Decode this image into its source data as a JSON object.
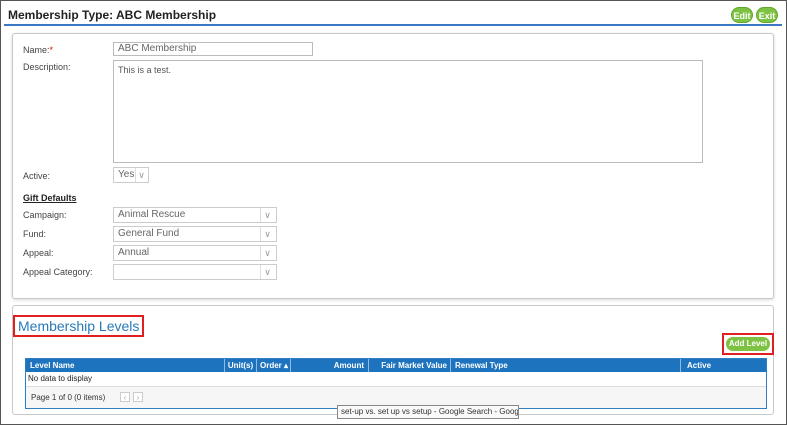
{
  "header": {
    "title": "Membership Type: ABC Membership",
    "edit_label": "Edit",
    "exit_label": "Exit"
  },
  "form": {
    "name_label": "Name:",
    "name_required": "*",
    "name_value": "ABC Membership",
    "description_label": "Description:",
    "description_value": "This is a test.",
    "active_label": "Active:",
    "active_value": "Yes",
    "gift_defaults_title": "Gift Defaults",
    "campaign_label": "Campaign:",
    "campaign_value": "Animal Rescue",
    "fund_label": "Fund:",
    "fund_value": "General Fund",
    "appeal_label": "Appeal:",
    "appeal_value": "Annual",
    "appeal_category_label": "Appeal Category:",
    "appeal_category_value": ""
  },
  "levels": {
    "title": "Membership Levels",
    "add_label": "Add Level",
    "columns": [
      "Level Name",
      "Unit(s)",
      "Order",
      "Amount",
      "Fair Market Value",
      "Renewal Type",
      "Active"
    ],
    "empty_text": "No data to display",
    "pager_text": "Page 1 of 0 (0 items)"
  },
  "tooltip": {
    "text": "set-up vs. set up vs setup - Google Search - Google"
  },
  "colors": {
    "accent_green": "#7dc242",
    "grid_header_blue": "#1e73be",
    "title_blue": "#2a7ab8",
    "highlight_red": "#e02020"
  },
  "icons": {
    "sort": "sort-icon",
    "dropdown": "chevron-down-icon",
    "prev": "chevron-left-icon",
    "next": "chevron-right-icon"
  }
}
